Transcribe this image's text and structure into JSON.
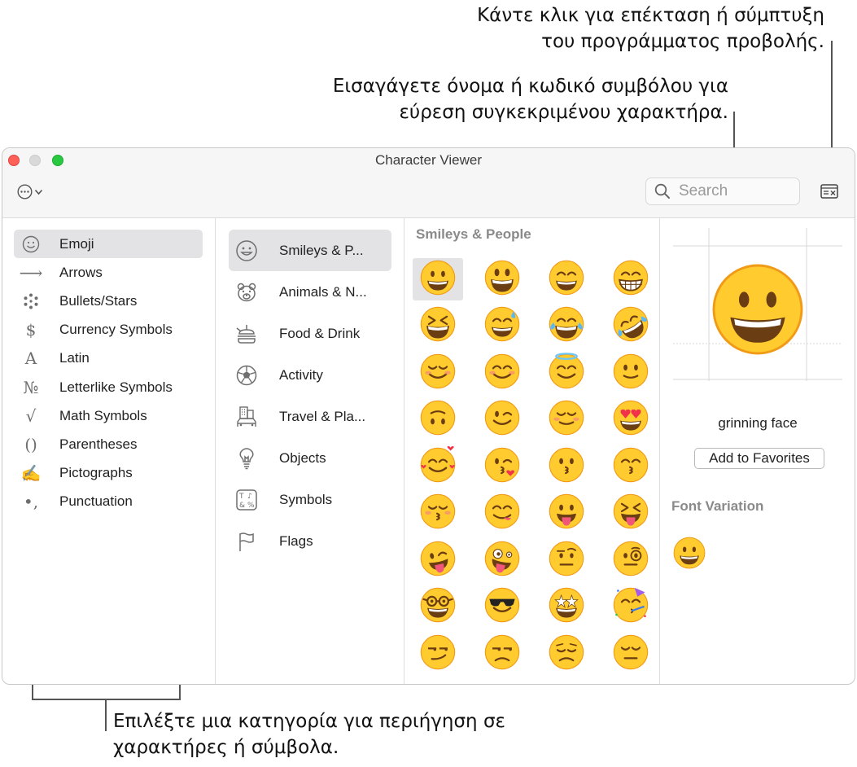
{
  "annotations": {
    "toggle_line1": "Κάντε κλικ για επέκταση ή σύμπτυξη",
    "toggle_line2": "του προγράμματος προβολής.",
    "search_line1": "Εισαγάγετε όνομα ή κωδικό συμβόλου για",
    "search_line2": "εύρεση συγκεκριμένου χαρακτήρα.",
    "category_line1": "Επιλέξτε μια κατηγορία για περιήγηση σε",
    "category_line2": "χαρακτήρες ή σύμβολα."
  },
  "window": {
    "title": "Character Viewer",
    "search_placeholder": "Search",
    "search_value": ""
  },
  "categories": [
    {
      "label": "Emoji",
      "icon": "smiley-outline-icon",
      "glyph": "",
      "selected": true
    },
    {
      "label": "Arrows",
      "icon": "arrow-right-icon",
      "glyph": "⟶",
      "selected": false
    },
    {
      "label": "Bullets/Stars",
      "icon": "asterisk-icon",
      "glyph": "",
      "selected": false
    },
    {
      "label": "Currency Symbols",
      "icon": "dollar-icon",
      "glyph": "$",
      "selected": false
    },
    {
      "label": "Latin",
      "icon": "latin-a-icon",
      "glyph": "A",
      "selected": false
    },
    {
      "label": "Letterlike Symbols",
      "icon": "numero-icon",
      "glyph": "№",
      "selected": false
    },
    {
      "label": "Math Symbols",
      "icon": "square-root-icon",
      "glyph": "√",
      "selected": false
    },
    {
      "label": "Parentheses",
      "icon": "parentheses-icon",
      "glyph": "()",
      "selected": false
    },
    {
      "label": "Pictographs",
      "icon": "writing-hand-icon",
      "glyph": "✍",
      "selected": false
    },
    {
      "label": "Punctuation",
      "icon": "punctuation-icon",
      "glyph": "•,",
      "selected": false
    }
  ],
  "subcategories": [
    {
      "label": "Smileys & P...",
      "icon": "smiley-outline-icon",
      "selected": true
    },
    {
      "label": "Animals & N...",
      "icon": "bear-face-icon",
      "selected": false
    },
    {
      "label": "Food & Drink",
      "icon": "food-drink-icon",
      "selected": false
    },
    {
      "label": "Activity",
      "icon": "soccer-ball-icon",
      "selected": false
    },
    {
      "label": "Travel & Pla...",
      "icon": "building-car-icon",
      "selected": false
    },
    {
      "label": "Objects",
      "icon": "light-bulb-icon",
      "selected": false
    },
    {
      "label": "Symbols",
      "icon": "symbols-box-icon",
      "selected": false
    },
    {
      "label": "Flags",
      "icon": "flag-icon",
      "selected": false
    }
  ],
  "emoji_section": {
    "title": "Smileys & People",
    "emojis": [
      {
        "name": "grinning face",
        "icon": "grinning-face-icon",
        "selected": true
      },
      {
        "name": "grinning face with big eyes",
        "icon": "grinning-big-eyes-icon"
      },
      {
        "name": "grinning face with smiling eyes",
        "icon": "grinning-smiling-eyes-icon"
      },
      {
        "name": "beaming face",
        "icon": "beaming-face-icon"
      },
      {
        "name": "grinning squinting face",
        "icon": "grinning-squinting-icon"
      },
      {
        "name": "grinning face with sweat",
        "icon": "grinning-sweat-icon"
      },
      {
        "name": "face with tears of joy",
        "icon": "tears-of-joy-icon"
      },
      {
        "name": "rolling on the floor laughing",
        "icon": "rofl-icon"
      },
      {
        "name": "smiling face",
        "icon": "smiling-face-icon"
      },
      {
        "name": "smiling face with smiling eyes",
        "icon": "blush-icon"
      },
      {
        "name": "smiling face with halo",
        "icon": "halo-face-icon"
      },
      {
        "name": "slightly smiling face",
        "icon": "slight-smile-icon"
      },
      {
        "name": "upside-down face",
        "icon": "upside-down-icon"
      },
      {
        "name": "winking face",
        "icon": "wink-icon"
      },
      {
        "name": "relieved face",
        "icon": "relieved-icon"
      },
      {
        "name": "smiling face with heart-eyes",
        "icon": "heart-eyes-icon"
      },
      {
        "name": "smiling face with hearts",
        "icon": "hearts-face-icon"
      },
      {
        "name": "face blowing a kiss",
        "icon": "blow-kiss-icon"
      },
      {
        "name": "kissing face",
        "icon": "kissing-icon"
      },
      {
        "name": "kissing face with smiling eyes",
        "icon": "kissing-smiling-eyes-icon"
      },
      {
        "name": "kissing face with closed eyes",
        "icon": "kissing-closed-eyes-icon"
      },
      {
        "name": "face savoring food",
        "icon": "yum-icon"
      },
      {
        "name": "face with tongue",
        "icon": "tongue-icon"
      },
      {
        "name": "squinting face with tongue",
        "icon": "squint-tongue-icon"
      },
      {
        "name": "winking face with tongue",
        "icon": "wink-tongue-icon"
      },
      {
        "name": "zany face",
        "icon": "zany-icon"
      },
      {
        "name": "face with raised eyebrow",
        "icon": "raised-eyebrow-icon"
      },
      {
        "name": "face with monocle",
        "icon": "monocle-icon"
      },
      {
        "name": "nerd face",
        "icon": "nerd-icon"
      },
      {
        "name": "smiling face with sunglasses",
        "icon": "sunglasses-icon"
      },
      {
        "name": "star-struck",
        "icon": "star-struck-icon"
      },
      {
        "name": "partying face",
        "icon": "partying-icon"
      },
      {
        "name": "smirking face",
        "icon": "smirk-icon"
      },
      {
        "name": "unamused face",
        "icon": "unamused-icon"
      },
      {
        "name": "disappointed face",
        "icon": "disappointed-icon"
      },
      {
        "name": "pensive face",
        "icon": "pensive-icon"
      }
    ]
  },
  "detail": {
    "name": "grinning face",
    "add_favorites": "Add to Favorites",
    "font_variation_title": "Font Variation"
  },
  "colors": {
    "emoji_yellow": "#FFCB2E",
    "emoji_edge": "#F09A17",
    "feature": "#6B3D12",
    "heart": "#F0334A",
    "selection": "#E3E3E5"
  }
}
